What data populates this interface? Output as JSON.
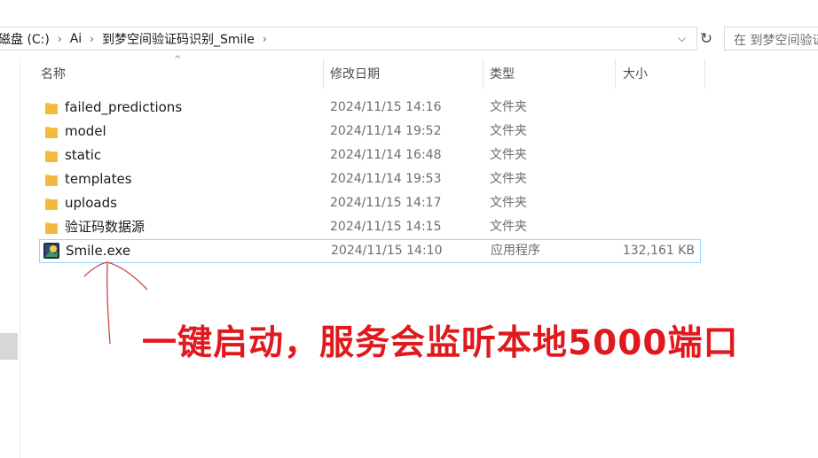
{
  "address_bar": {
    "crumbs": [
      "磁盘 (C:)",
      "Ai",
      "到梦空间验证码识别_Smile"
    ]
  },
  "search": {
    "placeholder": "在 到梦空间验证"
  },
  "columns": {
    "name": "名称",
    "modified": "修改日期",
    "type": "类型",
    "size": "大小"
  },
  "files": [
    {
      "name": "failed_predictions",
      "modified": "2024/11/15 14:16",
      "type": "文件夹",
      "size": "",
      "icon": "folder-icon"
    },
    {
      "name": "model",
      "modified": "2024/11/14 19:52",
      "type": "文件夹",
      "size": "",
      "icon": "folder-icon"
    },
    {
      "name": "static",
      "modified": "2024/11/14 16:48",
      "type": "文件夹",
      "size": "",
      "icon": "folder-icon"
    },
    {
      "name": "templates",
      "modified": "2024/11/14 19:53",
      "type": "文件夹",
      "size": "",
      "icon": "folder-icon"
    },
    {
      "name": "uploads",
      "modified": "2024/11/15 14:17",
      "type": "文件夹",
      "size": "",
      "icon": "folder-icon"
    },
    {
      "name": "验证码数据源",
      "modified": "2024/11/15 14:15",
      "type": "文件夹",
      "size": "",
      "icon": "folder-icon"
    },
    {
      "name": "Smile.exe",
      "modified": "2024/11/15 14:10",
      "type": "应用程序",
      "size": "132,161 KB",
      "icon": "app-icon"
    }
  ],
  "annotation": {
    "text": "一键启动，服务会监听本地5000端口"
  },
  "colors": {
    "annotation": "#e0191e",
    "folder": "#f8c94a",
    "selection_border": "#99d1ff"
  }
}
